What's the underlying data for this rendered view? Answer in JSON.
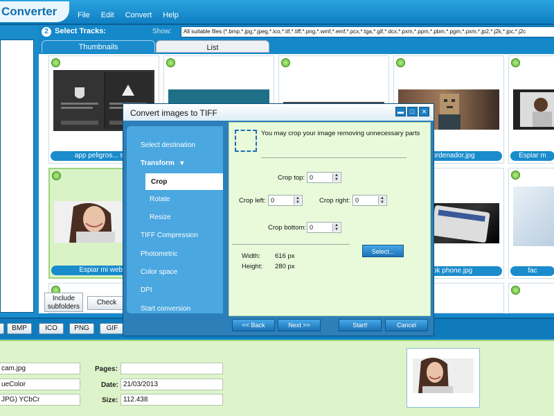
{
  "app": {
    "title": "Converter"
  },
  "menu": [
    "File",
    "Edit",
    "Convert",
    "Help"
  ],
  "tracks": {
    "step": "2",
    "title": "Select Tracks:",
    "show_label": "Show:",
    "filter": "All suitable files (*.bmp,*.jpg,*.jpeg,*.ico,*.tif,*.tiff,*.png,*.wmf,*.emf,*.pcx,*.tga,*.gif,*.dcx,*.pxm,*.ppm,*.pbm,*.pgm,*.pxm,*.jp2,*.j2k,*.jpc,*.j2c"
  },
  "tabs": [
    "Thumbnails",
    "List"
  ],
  "thumbnails": [
    {
      "caption": "app peligros... serv",
      "selected": false
    },
    {
      "caption": "",
      "selected": false
    },
    {
      "caption": "",
      "selected": false
    },
    {
      "caption": "do ordenador.jpg",
      "selected": false
    },
    {
      "caption": "Espiar m",
      "selected": false
    },
    {
      "caption": "Espiar mi webca",
      "selected": true
    },
    {
      "caption": "",
      "selected": false
    },
    {
      "caption": "",
      "selected": false
    },
    {
      "caption": "book phone.jpg",
      "selected": false
    },
    {
      "caption": "fac",
      "selected": false
    }
  ],
  "buttons": {
    "include": "Include subfolders",
    "check": "Check"
  },
  "formats": [
    "BMP",
    "ICO",
    "PNG",
    "GIF"
  ],
  "info": {
    "filename": "cam.jpg",
    "color": "ueColor",
    "compression": "JPG) YCbCr",
    "pages_label": "Pages:",
    "pages": "",
    "date_label": "Date:",
    "date": "21/03/2013",
    "size_label": "Size:",
    "size": "112.438"
  },
  "dialog": {
    "title": "Convert images to TIFF",
    "controls": {
      "min": "▬",
      "max": "□",
      "close": "✕"
    },
    "nav": {
      "select_destination": "Select destination",
      "transform": "Transform",
      "crop": "Crop",
      "rotate": "Rotate",
      "resize": "Resize",
      "tiff_compression": "TIFF Compression",
      "photometric": "Photometric",
      "color_space": "Color space",
      "dpi": "DPI",
      "start_conversion": "Start conversion"
    },
    "crop_desc": "You may crop your image removing unnecessary parts",
    "crop": {
      "top_label": "Crop top:",
      "top": "0",
      "left_label": "Crop left:",
      "left": "0",
      "right_label": "Crop right:",
      "right": "0",
      "bottom_label": "Crop bottom:",
      "bottom": "0"
    },
    "width_label": "Width:",
    "width": "616 px",
    "height_label": "Height:",
    "height": "280 px",
    "select_btn": "Select...",
    "back": "<< Back",
    "next": "Next >>",
    "start": "Start!",
    "cancel": "Cancel"
  },
  "colors": {
    "accent": "#1588c9",
    "panel_green": "#ddf3c9"
  }
}
